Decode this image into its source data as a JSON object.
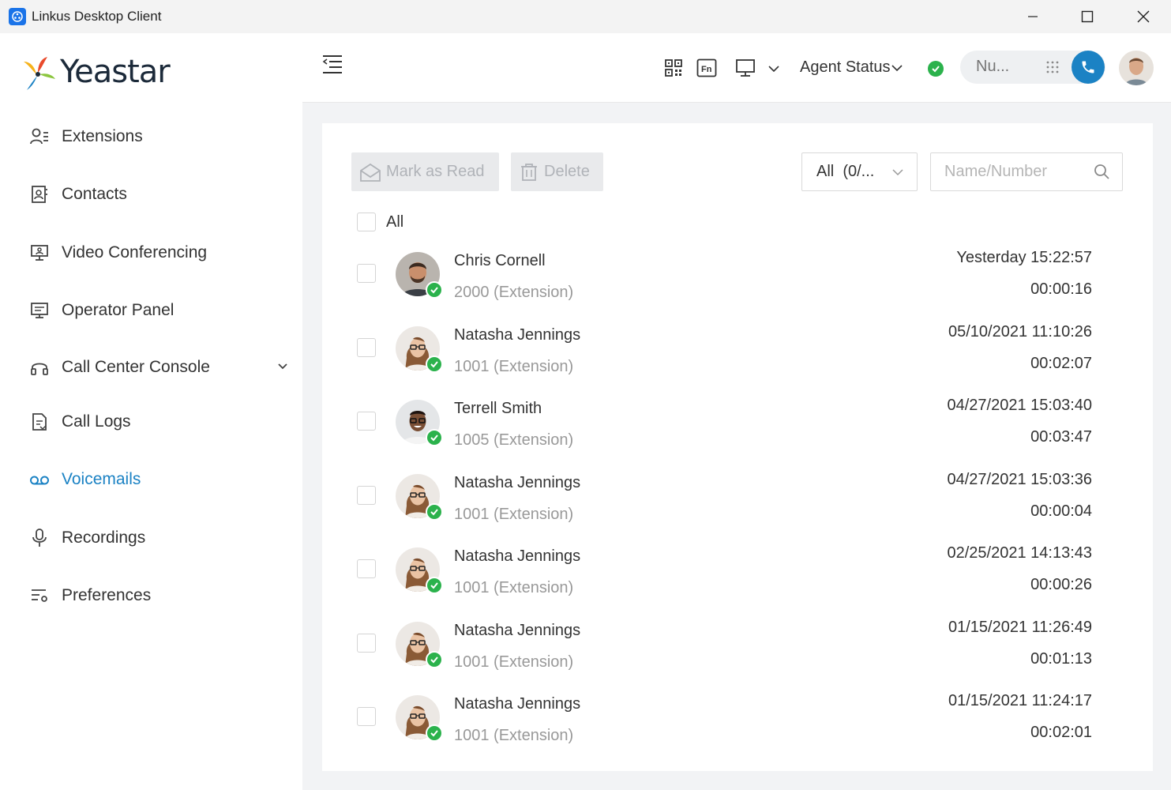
{
  "window": {
    "title": "Linkus Desktop Client"
  },
  "brand": {
    "name": "Yeastar"
  },
  "sidebar": {
    "items": [
      {
        "label": "Extensions",
        "icon": "extensions-icon"
      },
      {
        "label": "Contacts",
        "icon": "contacts-icon"
      },
      {
        "label": "Video Conferencing",
        "icon": "video-conference-icon"
      },
      {
        "label": "Operator Panel",
        "icon": "operator-panel-icon"
      },
      {
        "label": "Call Center Console",
        "icon": "headset-icon"
      },
      {
        "label": "Call Logs",
        "icon": "call-logs-icon"
      },
      {
        "label": "Voicemails",
        "icon": "voicemail-icon",
        "active": true
      },
      {
        "label": "Recordings",
        "icon": "microphone-icon"
      },
      {
        "label": "Preferences",
        "icon": "preferences-icon"
      }
    ]
  },
  "header": {
    "agent_status": "Agent Status",
    "dialer_placeholder": "Nu..."
  },
  "toolbar": {
    "mark_read": "Mark as Read",
    "delete": "Delete",
    "filter": "All  (0/...",
    "search_placeholder": "Name/Number"
  },
  "list": {
    "select_all": "All",
    "rows": [
      {
        "name": "Chris Cornell",
        "number": "2000 (Extension)",
        "time": "Yesterday 15:22:57",
        "duration": "00:00:16"
      },
      {
        "name": "Natasha Jennings",
        "number": "1001 (Extension)",
        "time": "05/10/2021 11:10:26",
        "duration": "00:02:07"
      },
      {
        "name": "Terrell Smith",
        "number": "1005 (Extension)",
        "time": "04/27/2021 15:03:40",
        "duration": "00:03:47"
      },
      {
        "name": "Natasha Jennings",
        "number": "1001 (Extension)",
        "time": "04/27/2021 15:03:36",
        "duration": "00:00:04"
      },
      {
        "name": "Natasha Jennings",
        "number": "1001 (Extension)",
        "time": "02/25/2021 14:13:43",
        "duration": "00:00:26"
      },
      {
        "name": "Natasha Jennings",
        "number": "1001 (Extension)",
        "time": "01/15/2021 11:26:49",
        "duration": "00:01:13"
      },
      {
        "name": "Natasha Jennings",
        "number": "1001 (Extension)",
        "time": "01/15/2021 11:24:17",
        "duration": "00:02:01"
      }
    ]
  },
  "colors": {
    "accent": "#1b82c4",
    "online": "#2bb24c",
    "sidebar_bg": "#ffffff",
    "page_bg": "#f2f3f5"
  }
}
